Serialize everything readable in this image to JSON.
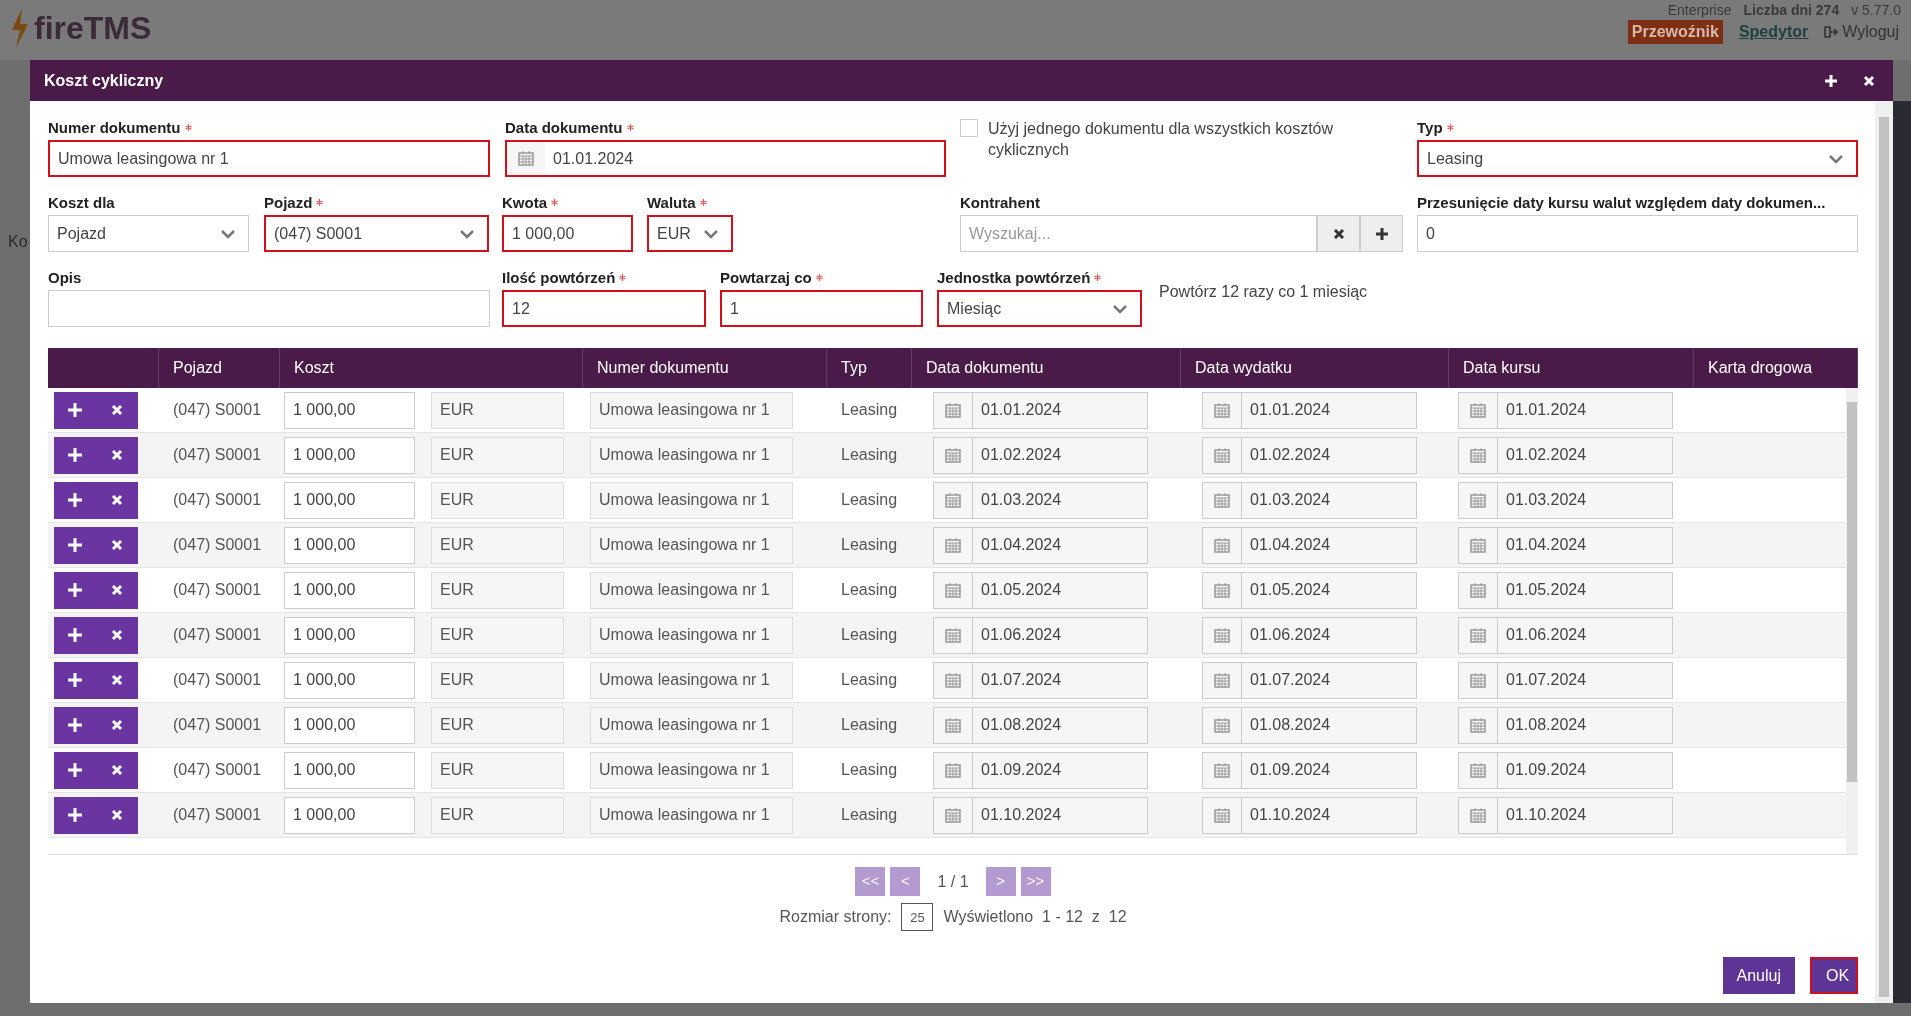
{
  "backdrop": {
    "logo": "fireTMS",
    "edition": "Enterprise",
    "days": "Liczba dni 274",
    "version": "v 5.77.0",
    "roles": [
      {
        "label": "Przewoźnik",
        "selected": true
      },
      {
        "label": "Spedytor",
        "selected": false
      }
    ],
    "logout": "Wyloguj",
    "sidebar_text": "Ko"
  },
  "dialog": {
    "title": "Koszt cykliczny",
    "form": {
      "rows": [
        {
          "fields": [
            {
              "kind": "text",
              "label": "Numer dokumentu",
              "required": true,
              "invalid": true,
              "value": "Umowa leasingowa nr 1"
            },
            {
              "kind": "date",
              "label": "Data dokumentu",
              "required": true,
              "invalid": true,
              "value": "01.01.2024"
            },
            {
              "kind": "checkbox",
              "label": "Użyj jednego dokumentu dla wszystkich kosztów cyklicznych",
              "checked": false
            },
            {
              "kind": "select",
              "label": "Typ",
              "required": true,
              "invalid": true,
              "value": "Leasing"
            }
          ]
        },
        {
          "fields": [
            {
              "kind": "select",
              "label": "Koszt dla",
              "required": false,
              "invalid": false,
              "value": "Pojazd"
            },
            {
              "kind": "select",
              "label": "Pojazd",
              "required": true,
              "invalid": true,
              "value": "(047) S0001"
            },
            {
              "kind": "text",
              "label": "Kwota",
              "required": true,
              "invalid": true,
              "value": "1 000,00"
            },
            {
              "kind": "select",
              "label": "Waluta",
              "required": true,
              "invalid": true,
              "value": "EUR"
            },
            {
              "kind": "search",
              "label": "Kontrahent",
              "required": false,
              "invalid": false,
              "placeholder": "Wyszukaj..."
            },
            {
              "kind": "text",
              "label": "Przesunięcie daty kursu walut względem daty dokumen...",
              "required": false,
              "invalid": false,
              "value": "0"
            }
          ]
        },
        {
          "fields": [
            {
              "kind": "text",
              "label": "Opis",
              "required": false,
              "invalid": false
            },
            {
              "kind": "text",
              "label": "Ilość powtórzeń",
              "required": true,
              "invalid": true,
              "value": "12"
            },
            {
              "kind": "text",
              "label": "Powtarzaj co",
              "required": true,
              "invalid": true,
              "value": "1"
            },
            {
              "kind": "select",
              "label": "Jednostka powtórzeń",
              "required": true,
              "invalid": true,
              "value": "Miesiąc"
            },
            {
              "kind": "note",
              "text": "Powtórz 12 razy co 1 miesiąc"
            }
          ]
        }
      ]
    },
    "table": {
      "columns": [
        "Pojazd",
        "Koszt",
        "Numer dokumentu",
        "Typ",
        "Data dokumentu",
        "Data wydatku",
        "Data kursu",
        "Karta drogowa"
      ],
      "rows": [
        {
          "vehicle": "(047) S0001",
          "amount": "1 000,00",
          "currency": "EUR",
          "doc_number": "Umowa leasingowa nr 1",
          "type": "Leasing",
          "doc_date": "01.01.2024",
          "expense_date": "01.01.2024",
          "rate_date": "01.01.2024"
        },
        {
          "vehicle": "(047) S0001",
          "amount": "1 000,00",
          "currency": "EUR",
          "doc_number": "Umowa leasingowa nr 1",
          "type": "Leasing",
          "doc_date": "01.02.2024",
          "expense_date": "01.02.2024",
          "rate_date": "01.02.2024"
        },
        {
          "vehicle": "(047) S0001",
          "amount": "1 000,00",
          "currency": "EUR",
          "doc_number": "Umowa leasingowa nr 1",
          "type": "Leasing",
          "doc_date": "01.03.2024",
          "expense_date": "01.03.2024",
          "rate_date": "01.03.2024"
        },
        {
          "vehicle": "(047) S0001",
          "amount": "1 000,00",
          "currency": "EUR",
          "doc_number": "Umowa leasingowa nr 1",
          "type": "Leasing",
          "doc_date": "01.04.2024",
          "expense_date": "01.04.2024",
          "rate_date": "01.04.2024"
        },
        {
          "vehicle": "(047) S0001",
          "amount": "1 000,00",
          "currency": "EUR",
          "doc_number": "Umowa leasingowa nr 1",
          "type": "Leasing",
          "doc_date": "01.05.2024",
          "expense_date": "01.05.2024",
          "rate_date": "01.05.2024"
        },
        {
          "vehicle": "(047) S0001",
          "amount": "1 000,00",
          "currency": "EUR",
          "doc_number": "Umowa leasingowa nr 1",
          "type": "Leasing",
          "doc_date": "01.06.2024",
          "expense_date": "01.06.2024",
          "rate_date": "01.06.2024"
        },
        {
          "vehicle": "(047) S0001",
          "amount": "1 000,00",
          "currency": "EUR",
          "doc_number": "Umowa leasingowa nr 1",
          "type": "Leasing",
          "doc_date": "01.07.2024",
          "expense_date": "01.07.2024",
          "rate_date": "01.07.2024"
        },
        {
          "vehicle": "(047) S0001",
          "amount": "1 000,00",
          "currency": "EUR",
          "doc_number": "Umowa leasingowa nr 1",
          "type": "Leasing",
          "doc_date": "01.08.2024",
          "expense_date": "01.08.2024",
          "rate_date": "01.08.2024"
        },
        {
          "vehicle": "(047) S0001",
          "amount": "1 000,00",
          "currency": "EUR",
          "doc_number": "Umowa leasingowa nr 1",
          "type": "Leasing",
          "doc_date": "01.09.2024",
          "expense_date": "01.09.2024",
          "rate_date": "01.09.2024"
        },
        {
          "vehicle": "(047) S0001",
          "amount": "1 000,00",
          "currency": "EUR",
          "doc_number": "Umowa leasingowa nr 1",
          "type": "Leasing",
          "doc_date": "01.10.2024",
          "expense_date": "01.10.2024",
          "rate_date": "01.10.2024"
        }
      ]
    },
    "pagination": {
      "first": "<<",
      "prev": "<",
      "page": "1 / 1",
      "next": ">",
      "last": ">>",
      "size_label": "Rozmiar strony:",
      "size": "25",
      "shown": "Wyświetlono  1 - 12  z  12"
    },
    "buttons": [
      {
        "label": "Anuluj",
        "invalid": false
      },
      {
        "label": "OK",
        "invalid": true
      }
    ]
  }
}
